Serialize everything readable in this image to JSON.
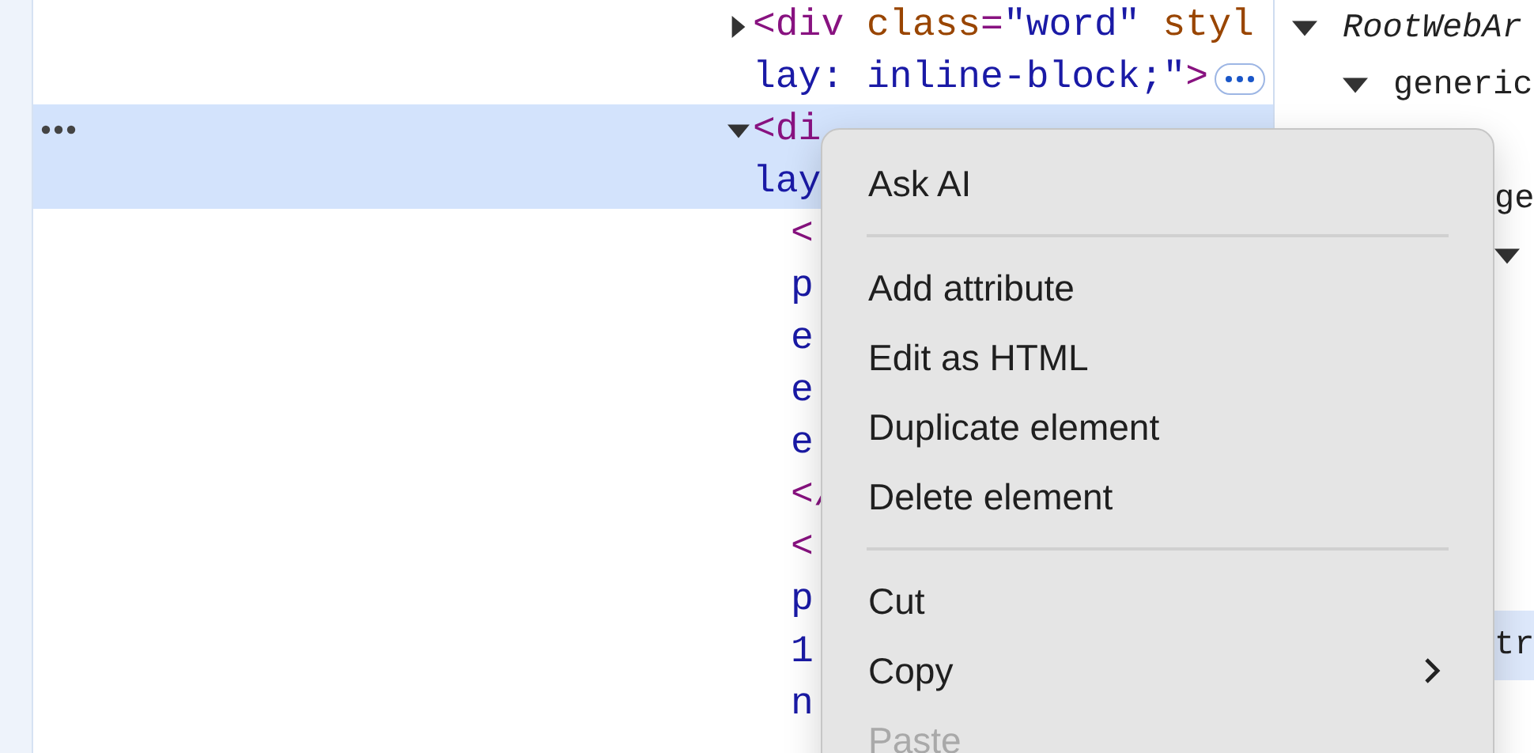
{
  "elements_panel": {
    "nodes": [
      {
        "expanded": false,
        "selected": false,
        "ellipsis": true,
        "lines": [
          [
            {
              "kind": "tag",
              "text": "<div"
            },
            {
              "kind": "attr",
              "text": " class"
            },
            {
              "kind": "tag",
              "text": "="
            },
            {
              "kind": "value",
              "text": "\"word\""
            },
            {
              "kind": "attr",
              "text": " styl"
            }
          ],
          [
            {
              "kind": "value",
              "text": "lay: inline-block;\""
            },
            {
              "kind": "tag",
              "text": ">"
            }
          ]
        ]
      },
      {
        "expanded": true,
        "selected": true,
        "lines": [
          [
            {
              "kind": "tag",
              "text": "<di"
            }
          ],
          [
            {
              "kind": "value",
              "text": "lay"
            }
          ]
        ],
        "children": [
          {
            "lines": [
              [
                {
                  "kind": "tag",
                  "text": "<"
                }
              ],
              [
                {
                  "kind": "value",
                  "text": "p"
                }
              ],
              [
                {
                  "kind": "value",
                  "text": "e"
                }
              ],
              [
                {
                  "kind": "value",
                  "text": "e"
                }
              ],
              [
                {
                  "kind": "value",
                  "text": "e"
                }
              ]
            ]
          },
          {
            "lines": [
              [
                {
                  "kind": "tag",
                  "text": "</"
                }
              ]
            ]
          },
          {
            "lines": [
              [
                {
                  "kind": "tag",
                  "text": "<"
                }
              ],
              [
                {
                  "kind": "value",
                  "text": "p"
                }
              ],
              [
                {
                  "kind": "value",
                  "text": "1"
                }
              ],
              [
                {
                  "kind": "value",
                  "text": "n"
                }
              ]
            ]
          }
        ]
      }
    ]
  },
  "accessibility_tree": {
    "nodes": [
      {
        "label": "RootWebAr",
        "kind": "root",
        "expanded": true,
        "children": [
          {
            "label": "generic",
            "kind": "node",
            "expanded": true,
            "children": [
              {
                "kind": "node",
                "children": [
                  {
                    "label": "ge",
                    "kind": "node",
                    "children": [
                      {
                        "kind": "node",
                        "expanded": true
                      },
                      {
                        "label": "tr",
                        "kind": "leaf",
                        "selected": true
                      }
                    ]
                  }
                ]
              }
            ]
          }
        ]
      }
    ]
  },
  "context_menu": {
    "items": [
      {
        "kind": "item",
        "label": "Ask AI",
        "disabled": false
      },
      {
        "kind": "separator"
      },
      {
        "kind": "item",
        "label": "Add attribute",
        "disabled": false
      },
      {
        "kind": "item",
        "label": "Edit as HTML",
        "disabled": false
      },
      {
        "kind": "item",
        "label": "Duplicate element",
        "disabled": false
      },
      {
        "kind": "item",
        "label": "Delete element",
        "disabled": false
      },
      {
        "kind": "separator"
      },
      {
        "kind": "item",
        "label": "Cut",
        "disabled": false
      },
      {
        "kind": "submenu",
        "label": "Copy",
        "disabled": false
      },
      {
        "kind": "item",
        "label": "Paste",
        "disabled": true
      }
    ]
  }
}
